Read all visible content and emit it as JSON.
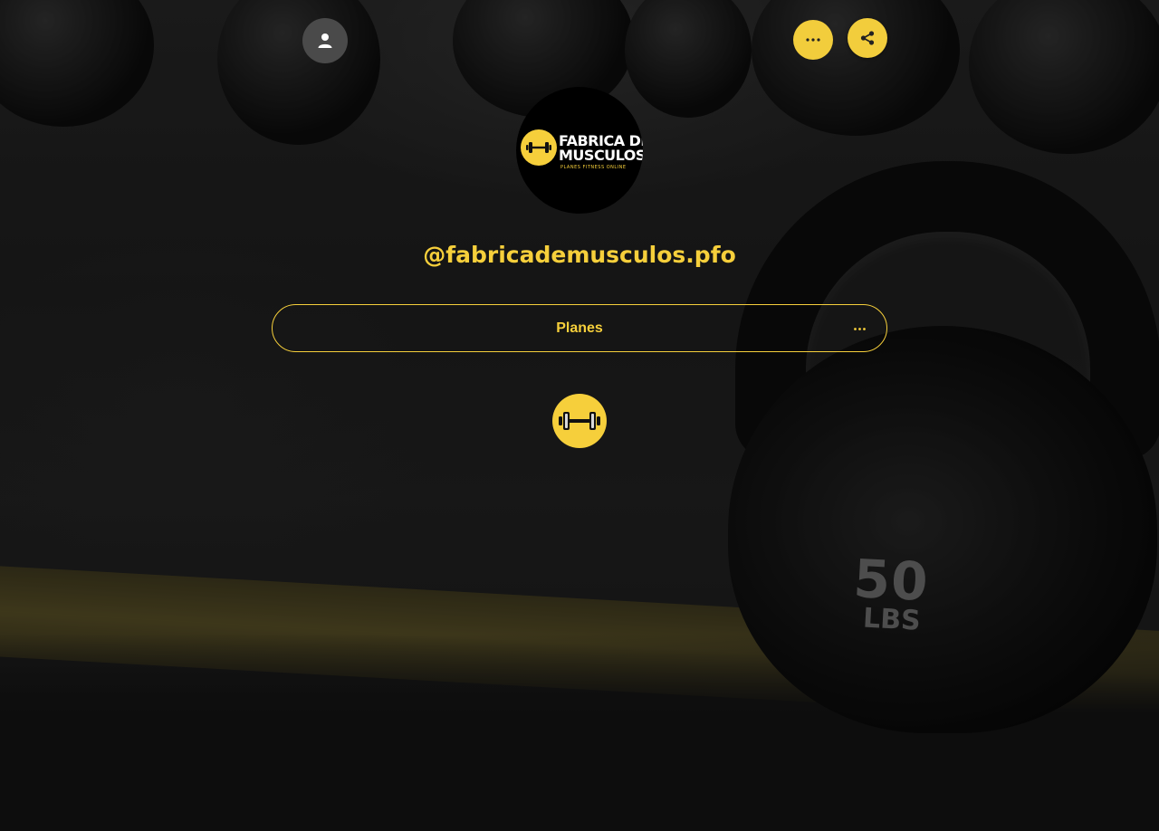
{
  "theme": {
    "accent": "#f6cf3b",
    "button_yellow": "#f2cd3c",
    "user_button_bg": "#4a4a4a",
    "text_light": "#ffffff"
  },
  "background": {
    "kettlebell_weight": "50",
    "kettlebell_unit": "LBS"
  },
  "header": {
    "user_icon": "user-icon",
    "more_icon": "more-horizontal-icon",
    "share_icon": "share-icon"
  },
  "profile": {
    "logo_line1": "FABRICA DE",
    "logo_line2": "MUSCULOS",
    "logo_tagline": "PLANES FITNESS ONLINE",
    "handle": "@fabricademusculos.pfo"
  },
  "links": [
    {
      "label": "Planes",
      "menu_icon": "more-horizontal-icon"
    }
  ],
  "social": {
    "icon": "dumbbell-icon"
  }
}
